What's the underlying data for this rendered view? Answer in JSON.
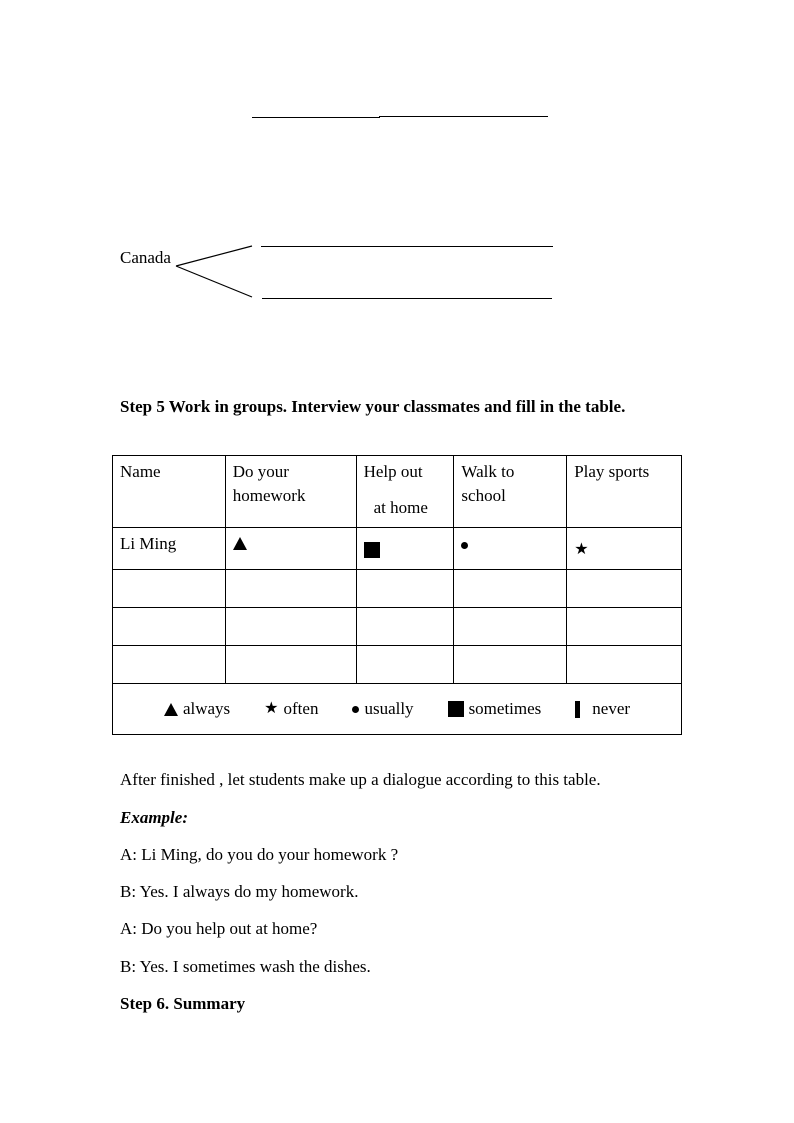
{
  "blank_line_top": {
    "segments": 2
  },
  "mind_map": {
    "center": "Canada",
    "branches": 2
  },
  "step5": {
    "heading": "Step 5 Work in groups. Interview your classmates and fill in the table.",
    "table": {
      "headers": [
        {
          "line1": "Name",
          "line2": ""
        },
        {
          "line1": "Do your",
          "line2": "homework"
        },
        {
          "line1": "Help out",
          "line2": "at home"
        },
        {
          "line1": "Walk to",
          "line2": "school"
        },
        {
          "line1": "Play sports",
          "line2": ""
        }
      ],
      "rows": [
        {
          "name": "Li Ming",
          "cells": [
            "triangle",
            "square",
            "dot",
            "star"
          ]
        },
        {
          "name": "",
          "cells": [
            "",
            "",
            "",
            ""
          ]
        },
        {
          "name": "",
          "cells": [
            "",
            "",
            "",
            ""
          ]
        },
        {
          "name": "",
          "cells": [
            "",
            "",
            "",
            ""
          ]
        }
      ],
      "legend": [
        {
          "symbol": "triangle",
          "label": "always"
        },
        {
          "symbol": "star",
          "label": "often"
        },
        {
          "symbol": "dot",
          "label": "usually"
        },
        {
          "symbol": "square",
          "label": "sometimes"
        },
        {
          "symbol": "bar",
          "label": "never"
        }
      ]
    }
  },
  "after_text": "After finished , let students make up a dialogue according to this table.",
  "example_label": "Example:",
  "dialogue": [
    "A: Li Ming, do you do your homework ?",
    "B: Yes. I always do my homework.",
    "A: Do you help out at home?",
    "B: Yes. I sometimes wash the dishes."
  ],
  "step6": "Step 6. Summary"
}
